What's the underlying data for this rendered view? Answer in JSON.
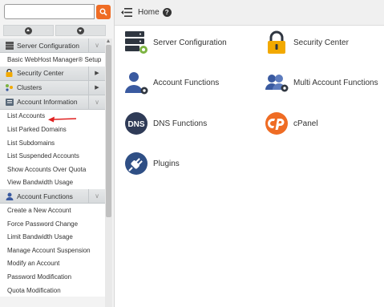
{
  "sidebar": {
    "search": {
      "placeholder": "",
      "value": ""
    },
    "categories": {
      "server_configuration": "Server Configuration",
      "security_center": "Security Center",
      "clusters": "Clusters",
      "account_information": "Account Information",
      "account_functions": "Account Functions"
    },
    "items": {
      "basic_setup": "Basic WebHost Manager® Setup",
      "list_accounts": "List Accounts",
      "list_parked_domains": "List Parked Domains",
      "list_subdomains": "List Subdomains",
      "list_suspended_accounts": "List Suspended Accounts",
      "show_accounts_over_quota": "Show Accounts Over Quota",
      "view_bandwidth_usage": "View Bandwidth Usage",
      "create_new_account": "Create a New Account",
      "force_password_change": "Force Password Change",
      "limit_bandwidth_usage": "Limit Bandwidth Usage",
      "manage_account_suspension": "Manage Account Suspension",
      "modify_an_account": "Modify an Account",
      "password_modification": "Password Modification",
      "quota_modification": "Quota Modification"
    }
  },
  "header": {
    "breadcrumb": "Home",
    "help_icon": "?"
  },
  "tiles": {
    "server_configuration": "Server Configuration",
    "security_center": "Security Center",
    "account_functions": "Account Functions",
    "multi_account_functions": "Multi Account Functions",
    "dns_functions": "DNS Functions",
    "dns_icon_text": "DNS",
    "cpanel": "cPanel",
    "plugins": "Plugins"
  },
  "colors": {
    "accent_orange": "#ef6c24",
    "icon_blue": "#3a5aa0",
    "icon_dark": "#2f3640",
    "annotation_red": "#e02020"
  }
}
